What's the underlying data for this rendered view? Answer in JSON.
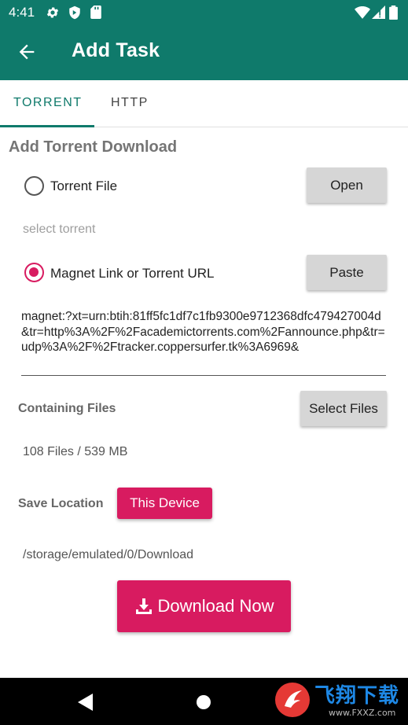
{
  "status": {
    "time": "4:41"
  },
  "appbar": {
    "title": "Add Task"
  },
  "tabs": [
    {
      "label": "TORRENT"
    },
    {
      "label": "HTTP"
    }
  ],
  "section_title": "Add Torrent Download",
  "torrent_file": {
    "label": "Torrent File",
    "button": "Open",
    "hint": "select torrent"
  },
  "magnet": {
    "label": "Magnet Link or Torrent URL",
    "button": "Paste",
    "value": "magnet:?xt=urn:btih:81ff5fc1df7c1fb9300e9712368dfc479427004d&tr=http%3A%2F%2Facademictorrents.com%2Fannounce.php&tr=udp%3A%2F%2Ftracker.coppersurfer.tk%3A6969&"
  },
  "files": {
    "label": "Containing Files",
    "button": "Select Files",
    "summary": "108 Files / 539 MB"
  },
  "save": {
    "label": "Save Location",
    "button": "This Device",
    "path": "/storage/emulated/0/Download"
  },
  "download": {
    "label": "Download Now"
  },
  "watermark": {
    "text": "飞翔下载",
    "sub": "www.FXXZ.com"
  },
  "colors": {
    "primary": "#0f7a6b",
    "accent": "#d81b60"
  }
}
